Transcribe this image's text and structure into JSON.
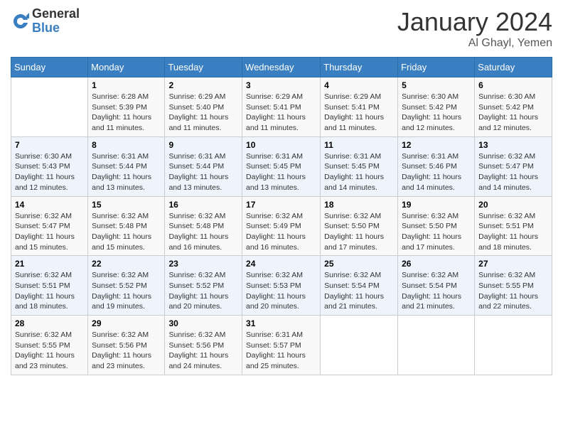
{
  "logo": {
    "general": "General",
    "blue": "Blue"
  },
  "header": {
    "month": "January 2024",
    "location": "Al Ghayl, Yemen"
  },
  "weekdays": [
    "Sunday",
    "Monday",
    "Tuesday",
    "Wednesday",
    "Thursday",
    "Friday",
    "Saturday"
  ],
  "weeks": [
    [
      {
        "day": "",
        "info": ""
      },
      {
        "day": "1",
        "info": "Sunrise: 6:28 AM\nSunset: 5:39 PM\nDaylight: 11 hours\nand 11 minutes."
      },
      {
        "day": "2",
        "info": "Sunrise: 6:29 AM\nSunset: 5:40 PM\nDaylight: 11 hours\nand 11 minutes."
      },
      {
        "day": "3",
        "info": "Sunrise: 6:29 AM\nSunset: 5:41 PM\nDaylight: 11 hours\nand 11 minutes."
      },
      {
        "day": "4",
        "info": "Sunrise: 6:29 AM\nSunset: 5:41 PM\nDaylight: 11 hours\nand 11 minutes."
      },
      {
        "day": "5",
        "info": "Sunrise: 6:30 AM\nSunset: 5:42 PM\nDaylight: 11 hours\nand 12 minutes."
      },
      {
        "day": "6",
        "info": "Sunrise: 6:30 AM\nSunset: 5:42 PM\nDaylight: 11 hours\nand 12 minutes."
      }
    ],
    [
      {
        "day": "7",
        "info": "Sunrise: 6:30 AM\nSunset: 5:43 PM\nDaylight: 11 hours\nand 12 minutes."
      },
      {
        "day": "8",
        "info": "Sunrise: 6:31 AM\nSunset: 5:44 PM\nDaylight: 11 hours\nand 13 minutes."
      },
      {
        "day": "9",
        "info": "Sunrise: 6:31 AM\nSunset: 5:44 PM\nDaylight: 11 hours\nand 13 minutes."
      },
      {
        "day": "10",
        "info": "Sunrise: 6:31 AM\nSunset: 5:45 PM\nDaylight: 11 hours\nand 13 minutes."
      },
      {
        "day": "11",
        "info": "Sunrise: 6:31 AM\nSunset: 5:45 PM\nDaylight: 11 hours\nand 14 minutes."
      },
      {
        "day": "12",
        "info": "Sunrise: 6:31 AM\nSunset: 5:46 PM\nDaylight: 11 hours\nand 14 minutes."
      },
      {
        "day": "13",
        "info": "Sunrise: 6:32 AM\nSunset: 5:47 PM\nDaylight: 11 hours\nand 14 minutes."
      }
    ],
    [
      {
        "day": "14",
        "info": "Sunrise: 6:32 AM\nSunset: 5:47 PM\nDaylight: 11 hours\nand 15 minutes."
      },
      {
        "day": "15",
        "info": "Sunrise: 6:32 AM\nSunset: 5:48 PM\nDaylight: 11 hours\nand 15 minutes."
      },
      {
        "day": "16",
        "info": "Sunrise: 6:32 AM\nSunset: 5:48 PM\nDaylight: 11 hours\nand 16 minutes."
      },
      {
        "day": "17",
        "info": "Sunrise: 6:32 AM\nSunset: 5:49 PM\nDaylight: 11 hours\nand 16 minutes."
      },
      {
        "day": "18",
        "info": "Sunrise: 6:32 AM\nSunset: 5:50 PM\nDaylight: 11 hours\nand 17 minutes."
      },
      {
        "day": "19",
        "info": "Sunrise: 6:32 AM\nSunset: 5:50 PM\nDaylight: 11 hours\nand 17 minutes."
      },
      {
        "day": "20",
        "info": "Sunrise: 6:32 AM\nSunset: 5:51 PM\nDaylight: 11 hours\nand 18 minutes."
      }
    ],
    [
      {
        "day": "21",
        "info": "Sunrise: 6:32 AM\nSunset: 5:51 PM\nDaylight: 11 hours\nand 18 minutes."
      },
      {
        "day": "22",
        "info": "Sunrise: 6:32 AM\nSunset: 5:52 PM\nDaylight: 11 hours\nand 19 minutes."
      },
      {
        "day": "23",
        "info": "Sunrise: 6:32 AM\nSunset: 5:52 PM\nDaylight: 11 hours\nand 20 minutes."
      },
      {
        "day": "24",
        "info": "Sunrise: 6:32 AM\nSunset: 5:53 PM\nDaylight: 11 hours\nand 20 minutes."
      },
      {
        "day": "25",
        "info": "Sunrise: 6:32 AM\nSunset: 5:54 PM\nDaylight: 11 hours\nand 21 minutes."
      },
      {
        "day": "26",
        "info": "Sunrise: 6:32 AM\nSunset: 5:54 PM\nDaylight: 11 hours\nand 21 minutes."
      },
      {
        "day": "27",
        "info": "Sunrise: 6:32 AM\nSunset: 5:55 PM\nDaylight: 11 hours\nand 22 minutes."
      }
    ],
    [
      {
        "day": "28",
        "info": "Sunrise: 6:32 AM\nSunset: 5:55 PM\nDaylight: 11 hours\nand 23 minutes."
      },
      {
        "day": "29",
        "info": "Sunrise: 6:32 AM\nSunset: 5:56 PM\nDaylight: 11 hours\nand 23 minutes."
      },
      {
        "day": "30",
        "info": "Sunrise: 6:32 AM\nSunset: 5:56 PM\nDaylight: 11 hours\nand 24 minutes."
      },
      {
        "day": "31",
        "info": "Sunrise: 6:31 AM\nSunset: 5:57 PM\nDaylight: 11 hours\nand 25 minutes."
      },
      {
        "day": "",
        "info": ""
      },
      {
        "day": "",
        "info": ""
      },
      {
        "day": "",
        "info": ""
      }
    ]
  ]
}
